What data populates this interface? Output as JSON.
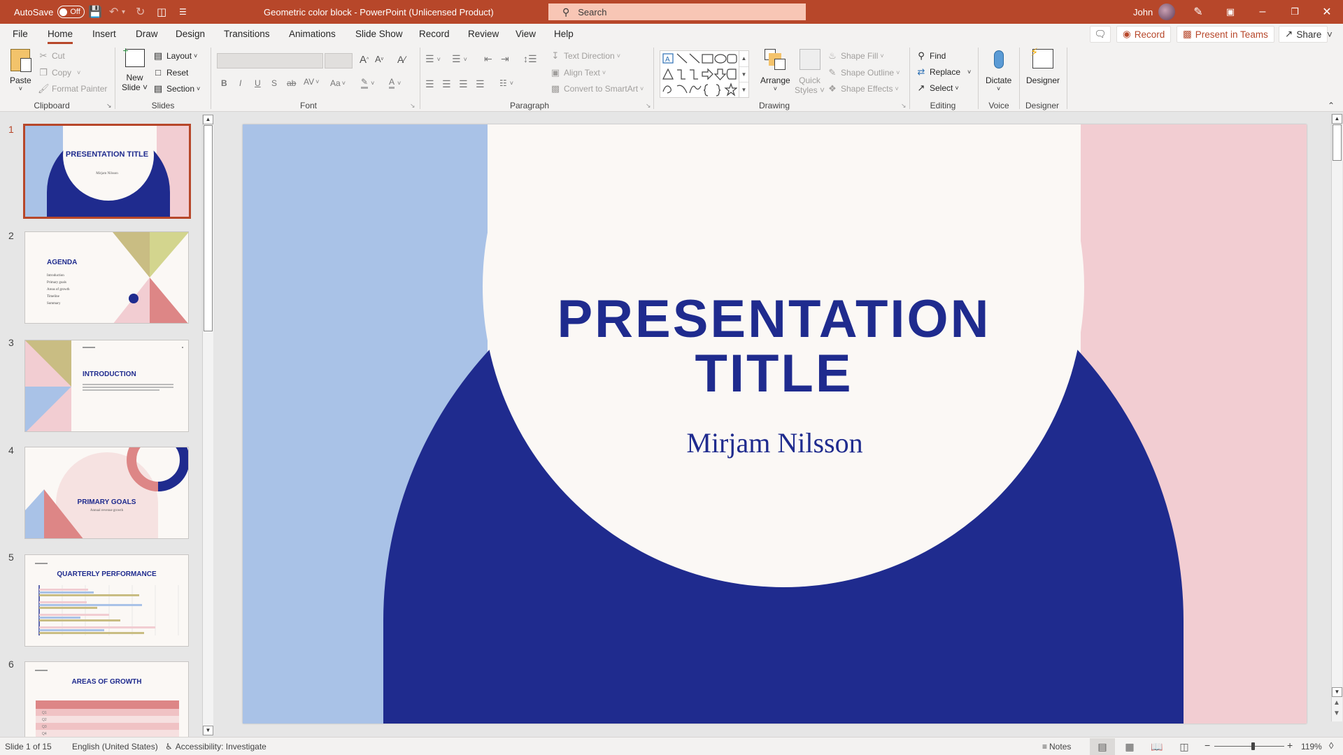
{
  "titlebar": {
    "autosave_label": "AutoSave",
    "autosave_state": "Off",
    "doc_title": "Geometric color block  -  PowerPoint (Unlicensed Product)",
    "search_placeholder": "Search",
    "user_name": "John",
    "accent_color": "#b7472a"
  },
  "tabs": [
    {
      "label": "File"
    },
    {
      "label": "Home",
      "active": true
    },
    {
      "label": "Insert"
    },
    {
      "label": "Draw"
    },
    {
      "label": "Design"
    },
    {
      "label": "Transitions"
    },
    {
      "label": "Animations"
    },
    {
      "label": "Slide Show"
    },
    {
      "label": "Record"
    },
    {
      "label": "Review"
    },
    {
      "label": "View"
    },
    {
      "label": "Help"
    }
  ],
  "tab_actions": {
    "record": "Record",
    "present_teams": "Present in Teams",
    "share": "Share"
  },
  "ribbon": {
    "clipboard": {
      "label": "Clipboard",
      "paste": "Paste",
      "cut": "Cut",
      "copy": "Copy",
      "format_painter": "Format Painter"
    },
    "slides": {
      "label": "Slides",
      "new_slide_1": "New",
      "new_slide_2": "Slide",
      "layout": "Layout",
      "reset": "Reset",
      "section": "Section"
    },
    "font": {
      "label": "Font",
      "bold": "B",
      "italic": "I",
      "underline": "U",
      "shadow": "S",
      "strike": "ab",
      "spacing": "AV",
      "case": "Aa",
      "grow": "A",
      "shrink": "A"
    },
    "paragraph": {
      "label": "Paragraph",
      "text_direction": "Text Direction",
      "align_text": "Align Text",
      "smartart": "Convert to SmartArt"
    },
    "drawing": {
      "label": "Drawing",
      "arrange": "Arrange",
      "quick_styles_1": "Quick",
      "quick_styles_2": "Styles",
      "shape_fill": "Shape Fill",
      "shape_outline": "Shape Outline",
      "shape_effects": "Shape Effects"
    },
    "editing": {
      "label": "Editing",
      "find": "Find",
      "replace": "Replace",
      "select": "Select"
    },
    "voice": {
      "label": "Voice",
      "dictate": "Dictate"
    },
    "designer": {
      "label": "Designer",
      "designer": "Designer"
    }
  },
  "thumbnails": [
    {
      "num": "1",
      "title": "PRESENTATION TITLE",
      "subtitle": "Mirjam Nilsson",
      "selected": true
    },
    {
      "num": "2",
      "title": "AGENDA",
      "items": [
        "Introduction",
        "Primary goals",
        "Areas of growth",
        "Timeline",
        "Summary"
      ]
    },
    {
      "num": "3",
      "title": "INTRODUCTION"
    },
    {
      "num": "4",
      "title": "PRIMARY GOALS",
      "subtitle": "Annual revenue growth"
    },
    {
      "num": "5",
      "title": "QUARTERLY PERFORMANCE"
    },
    {
      "num": "6",
      "title": "AREAS OF GROWTH",
      "rows": [
        "Q1",
        "Q2",
        "Q3",
        "Q4"
      ]
    }
  ],
  "slide": {
    "title_line1": "PRESENTATION",
    "title_line2": "TITLE",
    "subtitle": "Mirjam Nilsson",
    "colors": {
      "blue": "#a9c2e7",
      "navy": "#1f2b8e",
      "cream": "#fbf8f5",
      "pink": "#f2cdd2",
      "rose": "#dd8686",
      "olive": "#c9bd83",
      "lime": "#d3d58e"
    }
  },
  "statusbar": {
    "slide_info": "Slide 1 of 15",
    "language": "English (United States)",
    "accessibility": "Accessibility: Investigate",
    "notes": "Notes",
    "zoom": "119%",
    "zoom_fraction": 0.55
  }
}
